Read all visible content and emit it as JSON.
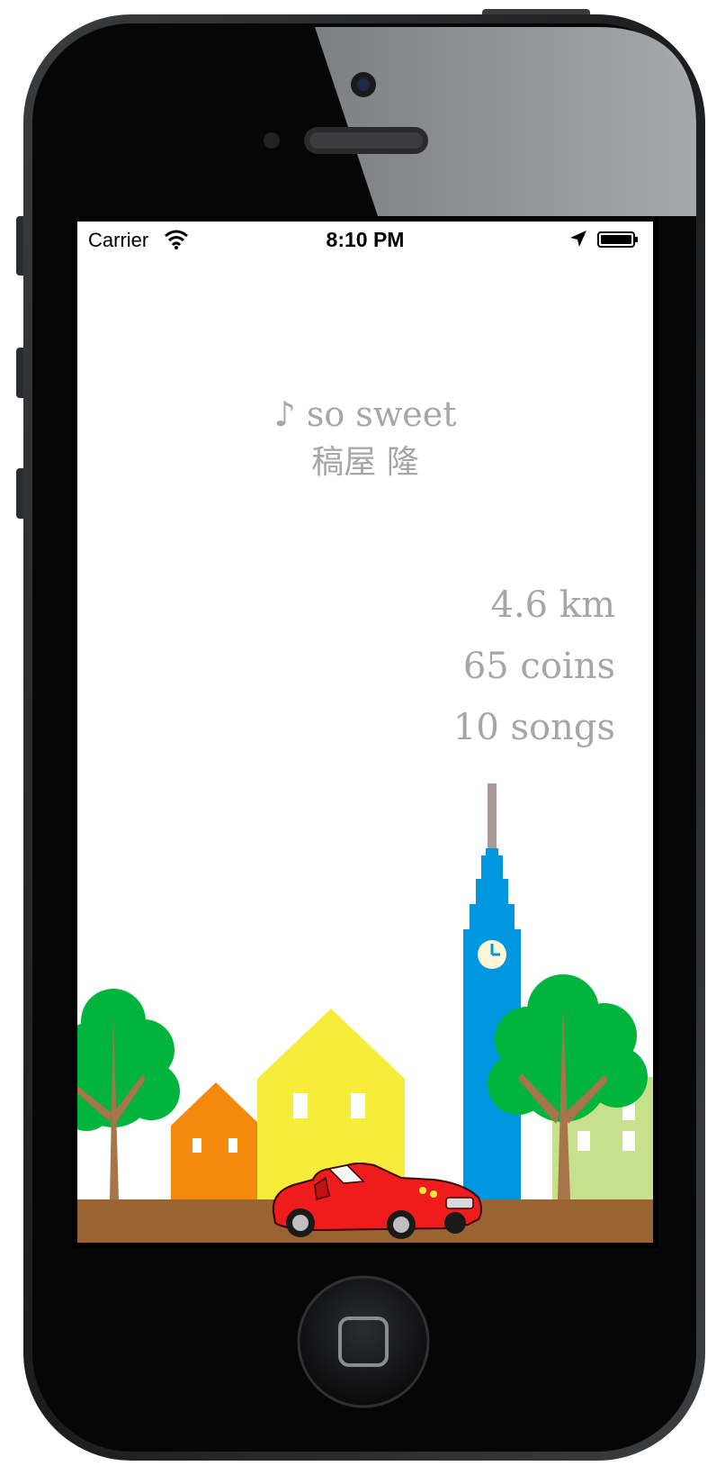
{
  "status_bar": {
    "carrier": "Carrier",
    "time": "8:10 PM",
    "icons": [
      "wifi-icon",
      "location-arrow-icon",
      "battery-icon"
    ]
  },
  "now_playing": {
    "note_symbol": "♪",
    "title": "so sweet",
    "artist": "稿屋 隆"
  },
  "stats": {
    "distance": "4.6 km",
    "coins": "65 coins",
    "songs": "10 songs"
  },
  "scene": {
    "ground_color": "#9a6432",
    "tower_color": "#0096e0",
    "house_colors": [
      "#f5890e",
      "#f6ec3a",
      "#c7e08c"
    ],
    "tree_color": "#00b43c",
    "car_color": "#ee1c1c"
  },
  "device": {
    "home_button_icon": "home-button-icon"
  }
}
